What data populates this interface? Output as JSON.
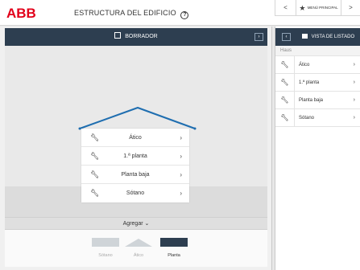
{
  "header": {
    "logo_text": "ABB",
    "title": "ESTRUCTURA DEL EDIFICIO",
    "help_icon": "?",
    "nav": {
      "prev": "<",
      "main_menu": "MENÚ PRINCIPAL",
      "next": ">"
    }
  },
  "toolbar": {
    "draft_label": "BORRADOR",
    "collapse_glyph": "›"
  },
  "floors": [
    {
      "label": "Ático"
    },
    {
      "label": "1.ª planta"
    },
    {
      "label": "Planta baja"
    },
    {
      "label": "Sótano"
    }
  ],
  "add_bar": {
    "label": "Agregar ⌄"
  },
  "thumbnails": [
    {
      "label": "Sótano"
    },
    {
      "label": "Ático"
    },
    {
      "label": "Planta"
    }
  ],
  "right_panel": {
    "expand_glyph": "‹",
    "list_view_label": "VISTA DE LISTADO",
    "section": "Haus",
    "items": [
      {
        "label": "Ático"
      },
      {
        "label": "1.ª planta"
      },
      {
        "label": "Planta baja"
      },
      {
        "label": "Sótano"
      }
    ]
  },
  "colors": {
    "brand_red": "#e2001a",
    "dark_bar": "#2d3e50",
    "roof_line": "#1f6eb0"
  },
  "icons": {
    "floor_edit": "wrench-icon",
    "chevron": "chevron-right-icon",
    "help": "help-circle-icon",
    "main_menu": "star-icon"
  }
}
